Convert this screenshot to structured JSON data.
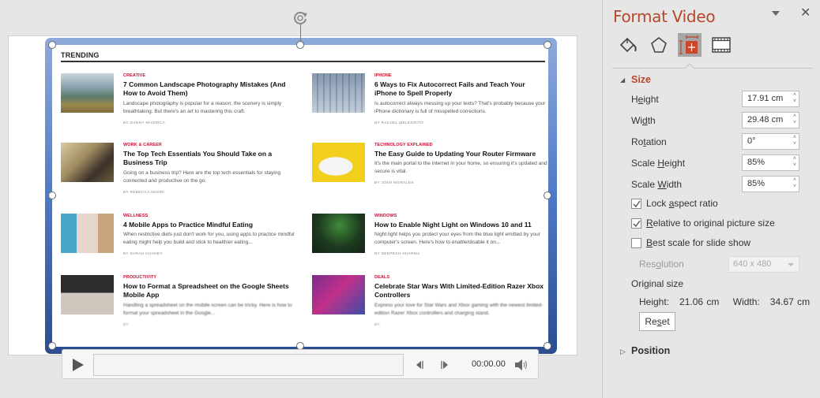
{
  "slide": {
    "heading": "TRENDING",
    "articles": [
      {
        "category": "CREATIVE",
        "title": "7 Common Landscape Photography Mistakes (And How to Avoid Them)",
        "description": "Landscape photography is popular for a reason; the scenery is simply breathtaking. But there's an art to mastering this craft.",
        "byline": "BY DANNY MAIORCA"
      },
      {
        "category": "IPHONE",
        "title": "6 Ways to Fix Autocorrect Fails and Teach Your iPhone to Spell Properly",
        "description": "Is autocorrect always messing up your texts? That's probably because your iPhone dictionary is full of misspelled corrections.",
        "byline": "BY RACHEL MELEGRITO"
      },
      {
        "category": "WORK & CAREER",
        "title": "The Top Tech Essentials You Should Take on a Business Trip",
        "description": "Going on a business trip? Here are the top tech essentials for staying connected and productive on the go.",
        "byline": "BY REBECCA NOORI"
      },
      {
        "category": "TECHNOLOGY EXPLAINED",
        "title": "The Easy Guide to Updating Your Router Firmware",
        "description": "It's the main portal to the internet in your home, so ensuring it's updated and secure is vital.",
        "byline": "BY JOSH MORALES"
      },
      {
        "category": "WELLNESS",
        "title": "4 Mobile Apps to Practice Mindful Eating",
        "description": "When restrictive diets just don't work for you, using apps to practice mindful eating might help you build and stick to healthier eating...",
        "byline": "BY SARAH CHANEY"
      },
      {
        "category": "WINDOWS",
        "title": "How to Enable Night Light on Windows 10 and 11",
        "description": "Night light helps you protect your eyes from the blue light emitted by your computer's screen. Here's how to enable/disable it on...",
        "byline": "BY DEEPESH SHARMA"
      },
      {
        "category": "PRODUCTIVITY",
        "title": "How to Format a Spreadsheet on the Google Sheets Mobile App",
        "description": "Handling a spreadsheet on the mobile screen can be tricky. Here is how to format your spreadsheet in the Google...",
        "byline": "BY"
      },
      {
        "category": "DEALS",
        "title": "Celebrate Star Wars With Limited-Edition Razer Xbox Controllers",
        "description": "Express your love for Star Wars and Xbox gaming with the newest limited-edition Razer Xbox controllers and charging stand.",
        "byline": "BY"
      }
    ]
  },
  "media_bar": {
    "time": "00:00.00",
    "progress": 0
  },
  "pane": {
    "title": "Format Video",
    "tabs": [
      "fill-line",
      "effects",
      "size-properties",
      "video"
    ],
    "selected_tab": "size-properties",
    "size_section": {
      "label": "Size",
      "expanded": true,
      "fields": [
        {
          "label": "Height",
          "value": "17.91 cm"
        },
        {
          "label": "Width",
          "value": "29.48 cm"
        },
        {
          "label": "Rotation",
          "value": "0°"
        },
        {
          "label": "Scale Height",
          "value": "85%"
        },
        {
          "label": "Scale Width",
          "value": "85%"
        }
      ],
      "checkboxes": [
        {
          "label": "Lock aspect ratio",
          "checked": true
        },
        {
          "label": "Relative to original picture size",
          "checked": true
        },
        {
          "label": "Best scale for slide show",
          "checked": false
        }
      ],
      "resolution_label": "Resolution",
      "resolution_value": "640 x 480",
      "original_size_label": "Original size",
      "original_height_label": "Height:",
      "original_height": "21.06 cm",
      "original_width_label": "Width:",
      "original_width": "34.67 cm",
      "reset_label": "Reset"
    },
    "position_section": {
      "label": "Position",
      "expanded": false
    },
    "accent_color": "#b7472a"
  }
}
